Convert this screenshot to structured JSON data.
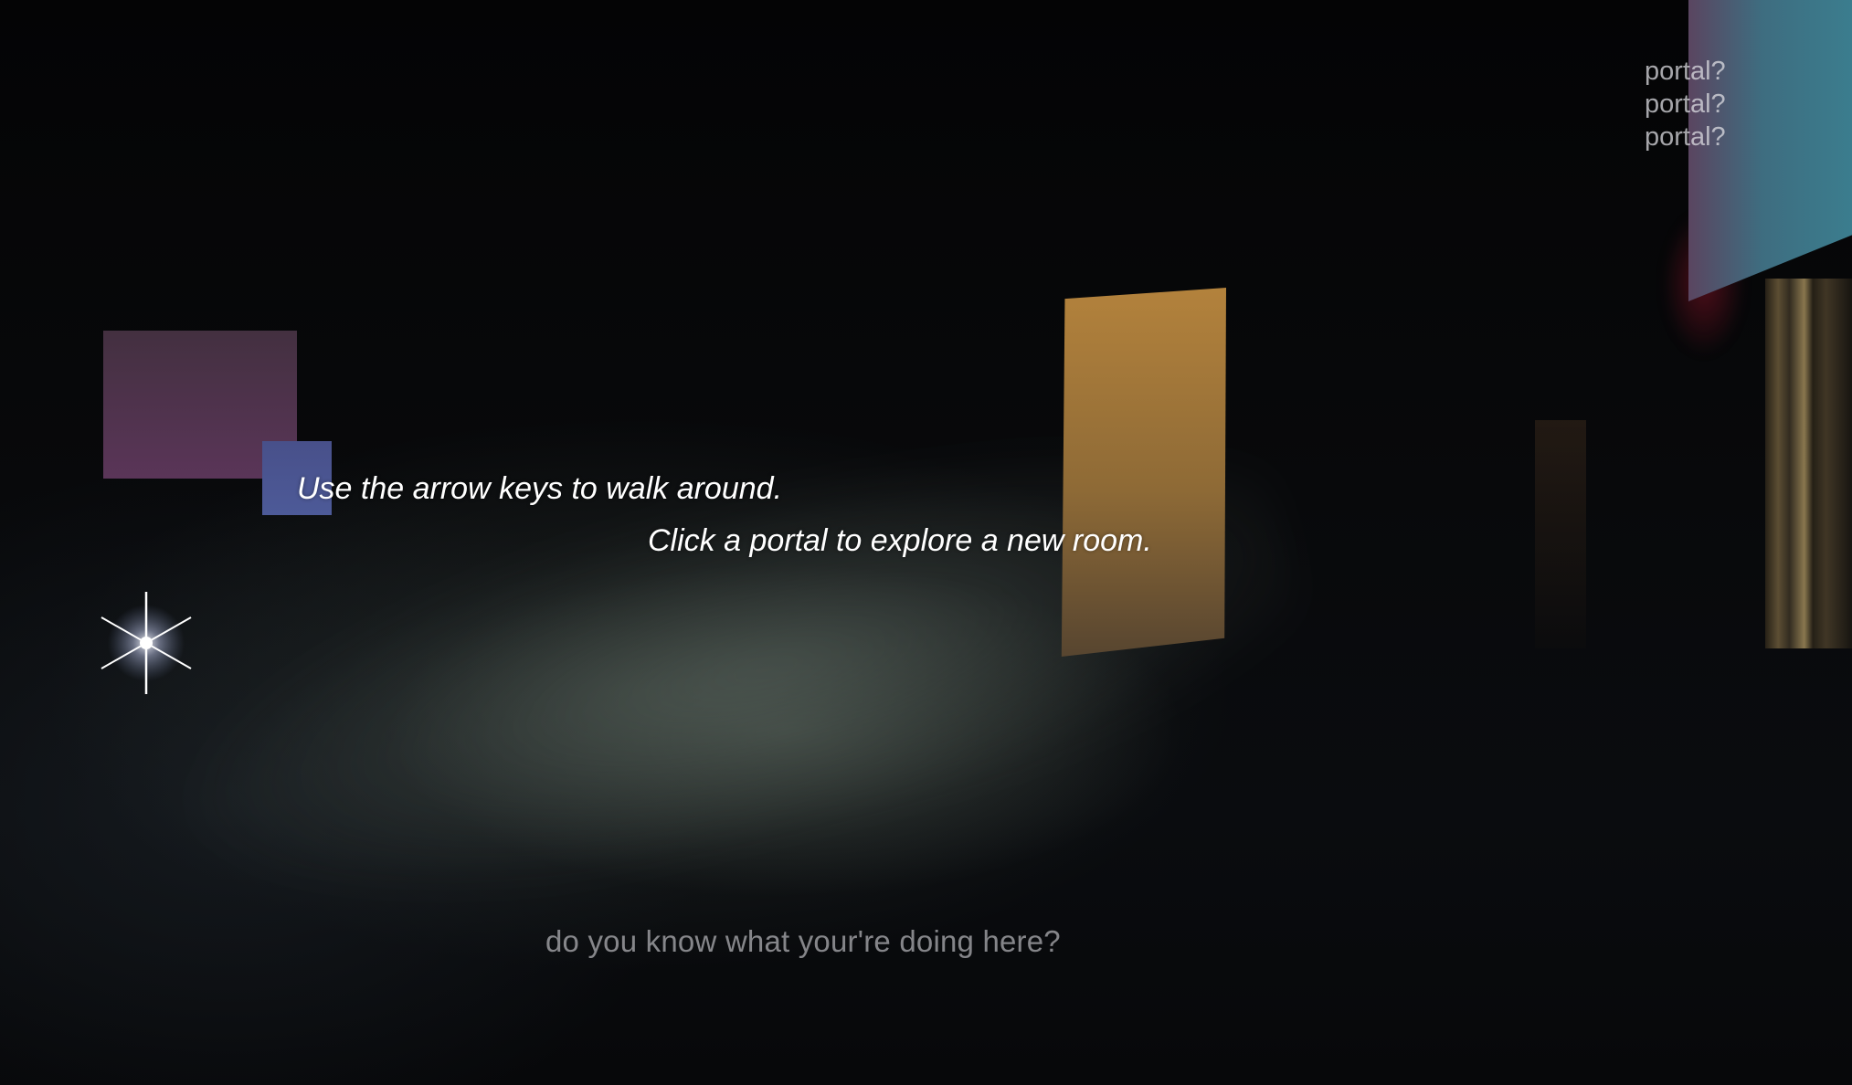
{
  "instructions": {
    "line1": "Use the arrow keys to walk around.",
    "line2": "Click a portal to explore a new room."
  },
  "portal_links": [
    "portal?",
    "portal?",
    "portal?"
  ],
  "prompt": "do you know what your're doing here?",
  "colors": {
    "portal_pink": "#5a3558",
    "portal_blue": "#4d5a98",
    "portal_gold": "#b3823c",
    "portal_teal": "#3b7d8e",
    "background": "#050507"
  },
  "icons": {
    "sparkle": "sparkle-icon"
  }
}
